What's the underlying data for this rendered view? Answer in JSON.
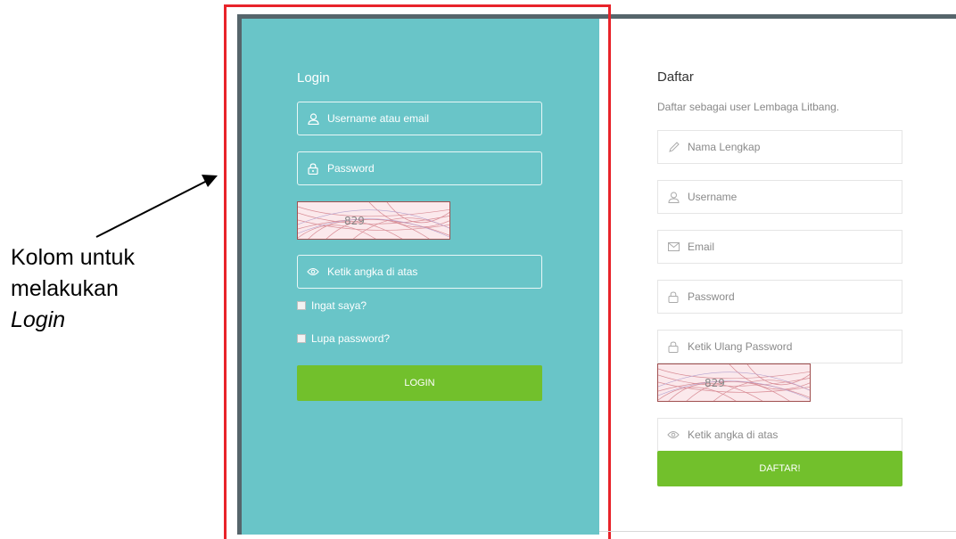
{
  "annotation": {
    "line1": "Kolom untuk",
    "line2": "melakukan",
    "line3": "Login"
  },
  "login": {
    "title": "Login",
    "username_placeholder": "Username atau email",
    "password_placeholder": "Password",
    "captcha_value": "829",
    "captcha_input_placeholder": "Ketik angka di atas",
    "remember_label": "Ingat saya?",
    "forgot_label": "Lupa password?",
    "button_label": "LOGIN"
  },
  "register": {
    "title": "Daftar",
    "subtitle": "Daftar sebagai user Lembaga Litbang.",
    "fullname_placeholder": "Nama Lengkap",
    "username_placeholder": "Username",
    "email_placeholder": "Email",
    "password_placeholder": "Password",
    "password_repeat_placeholder": "Ketik Ulang Password",
    "captcha_value": "829",
    "captcha_input_placeholder": "Ketik angka di atas",
    "button_label": "DAFTAR!"
  },
  "colors": {
    "login_panel": "#69c5c8",
    "button_green": "#72c02c",
    "highlight_red": "#e8232a",
    "frame_dark": "#56656b"
  }
}
